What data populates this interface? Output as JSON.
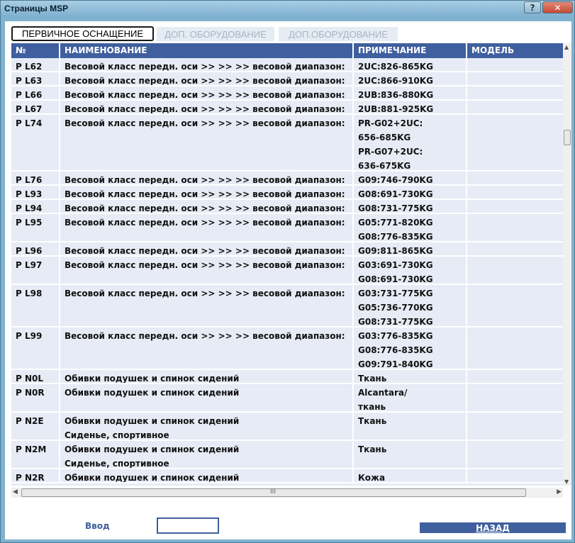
{
  "window": {
    "title": "Страницы MSP",
    "help_glyph": "?",
    "close_glyph": "✕"
  },
  "tabs": [
    {
      "label": "ПЕРВИЧНОЕ ОСНАЩЕНИЕ",
      "active": true
    },
    {
      "label": "ДОП. ОБОРУДОВАНИЕ",
      "active": false
    },
    {
      "label": "ДОП.ОБОРУДОВАНИЕ",
      "active": false
    }
  ],
  "table": {
    "headers": [
      "№",
      "НАИМЕНОВАНИЕ",
      "ПРИМЕЧАНИЕ",
      "МОДЕЛЬ"
    ],
    "rows": [
      {
        "code": "P L62",
        "name": [
          "Весовой класс передн. оси >> >> >> весовой диапазон:"
        ],
        "note": [
          "2UC:826-865KG"
        ],
        "model": ""
      },
      {
        "code": "P L63",
        "name": [
          "Весовой класс передн. оси >> >> >> весовой диапазон:"
        ],
        "note": [
          "2UC:866-910KG"
        ],
        "model": ""
      },
      {
        "code": "P L66",
        "name": [
          "Весовой класс передн. оси >> >> >> весовой диапазон:"
        ],
        "note": [
          "2UB:836-880KG"
        ],
        "model": ""
      },
      {
        "code": "P L67",
        "name": [
          "Весовой класс передн. оси >> >> >> весовой диапазон:"
        ],
        "note": [
          "2UB:881-925KG"
        ],
        "model": ""
      },
      {
        "code": "P L74",
        "name": [
          "Весовой класс передн. оси >> >> >> весовой диапазон:"
        ],
        "note": [
          "PR-G02+2UC:",
          "656-685KG",
          "PR-G07+2UC:",
          "636-675KG"
        ],
        "model": ""
      },
      {
        "code": "P L76",
        "name": [
          "Весовой класс передн. оси >> >> >> весовой диапазон:"
        ],
        "note": [
          "G09:746-790KG"
        ],
        "model": ""
      },
      {
        "code": "P L93",
        "name": [
          "Весовой класс передн. оси >> >> >> весовой диапазон:"
        ],
        "note": [
          "G08:691-730KG"
        ],
        "model": ""
      },
      {
        "code": "P L94",
        "name": [
          "Весовой класс передн. оси >> >> >> весовой диапазон:"
        ],
        "note": [
          "G08:731-775KG"
        ],
        "model": ""
      },
      {
        "code": "P L95",
        "name": [
          "Весовой класс передн. оси >> >> >> весовой диапазон:"
        ],
        "note": [
          "G05:771-820KG",
          "G08:776-835KG"
        ],
        "model": ""
      },
      {
        "code": "P L96",
        "name": [
          "Весовой класс передн. оси >> >> >> весовой диапазон:"
        ],
        "note": [
          "G09:811-865KG"
        ],
        "model": ""
      },
      {
        "code": "P L97",
        "name": [
          "Весовой класс передн. оси >> >> >> весовой диапазон:"
        ],
        "note": [
          "G03:691-730KG",
          "G08:691-730KG"
        ],
        "model": ""
      },
      {
        "code": "P L98",
        "name": [
          "Весовой класс передн. оси >> >> >> весовой диапазон:"
        ],
        "note": [
          "G03:731-775KG",
          "G05:736-770KG",
          "G08:731-775KG"
        ],
        "model": ""
      },
      {
        "code": "P L99",
        "name": [
          "Весовой класс передн. оси >> >> >> весовой диапазон:"
        ],
        "note": [
          "G03:776-835KG",
          "G08:776-835KG",
          "G09:791-840KG"
        ],
        "model": ""
      },
      {
        "code": "P N0L",
        "name": [
          "Обивки подушек и спинок сидений"
        ],
        "note": [
          "Ткань"
        ],
        "model": ""
      },
      {
        "code": "P N0R",
        "name": [
          "Обивки подушек и спинок сидений"
        ],
        "note": [
          "Alcantara/",
          "ткань"
        ],
        "model": ""
      },
      {
        "code": "P N2E",
        "name": [
          "Обивки подушек и спинок сидений",
          "Сиденье, спортивное"
        ],
        "note": [
          "Ткань"
        ],
        "model": ""
      },
      {
        "code": "P N2M",
        "name": [
          "Обивки подушек и спинок сидений",
          "Сиденье, спортивное"
        ],
        "note": [
          "Ткань"
        ],
        "model": ""
      },
      {
        "code": "P N2R",
        "name": [
          "Обивки подушек и спинок сидений"
        ],
        "note": [
          "Кожа"
        ],
        "model": ""
      }
    ]
  },
  "scroll": {
    "h_thumb_glyph": "III"
  },
  "footer": {
    "input_label": "Ввод",
    "input_value": "",
    "back_label": "НАЗАД"
  }
}
